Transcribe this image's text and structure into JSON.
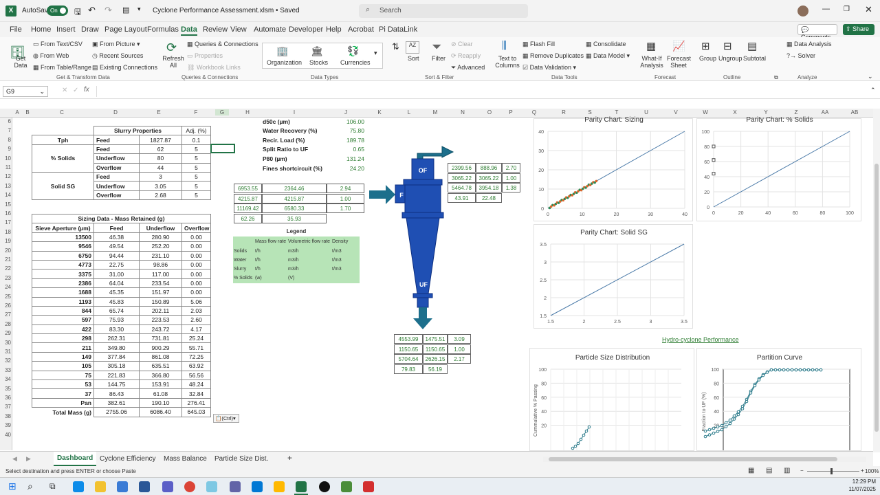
{
  "titlebar": {
    "app_letter": "X",
    "autosave_label": "AutoSave",
    "autosave_state": "On",
    "doc_title": "Cyclone Performance Assessment.xlsm • Saved",
    "search_placeholder": "Search"
  },
  "ribbon_tabs": [
    "File",
    "Home",
    "Insert",
    "Draw",
    "Page Layout",
    "Formulas",
    "Data",
    "Review",
    "View",
    "Automate",
    "Developer",
    "Help",
    "Acrobat",
    "Pi DataLink"
  ],
  "active_tab": "Data",
  "comments_label": "Comments",
  "share_label": "Share",
  "ribbon": {
    "get_data": "Get Data",
    "from_text_csv": "From Text/CSV",
    "from_web": "From Web",
    "from_table": "From Table/Range",
    "from_picture": "From Picture",
    "recent_sources": "Recent Sources",
    "existing_connections": "Existing Connections",
    "g1": "Get & Transform Data",
    "refresh_all": "Refresh All",
    "queries_connections": "Queries & Connections",
    "properties": "Properties",
    "workbook_links": "Workbook Links",
    "g2": "Queries & Connections",
    "organization": "Organization",
    "stocks": "Stocks",
    "currencies": "Currencies",
    "g3": "Data Types",
    "sort": "Sort",
    "filter": "Filter",
    "clear": "Clear",
    "reapply": "Reapply",
    "advanced": "Advanced",
    "g4": "Sort & Filter",
    "text_to_columns": "Text to Columns",
    "flash_fill": "Flash Fill",
    "remove_duplicates": "Remove Duplicates",
    "data_validation": "Data Validation",
    "consolidate": "Consolidate",
    "data_model": "Data Model",
    "g5": "Data Tools",
    "what_if": "What-If Analysis",
    "forecast_sheet": "Forecast Sheet",
    "g6": "Forecast",
    "group": "Group",
    "ungroup": "Ungroup",
    "subtotal": "Subtotal",
    "g7": "Outline",
    "data_analysis": "Data Analysis",
    "solver": "Solver",
    "g8": "Analyze"
  },
  "namebox": "G9",
  "columns": [
    "A",
    "B",
    "C",
    "D",
    "E",
    "F",
    "G",
    "H",
    "I",
    "J",
    "K",
    "L",
    "M",
    "N",
    "O",
    "P",
    "Q",
    "R",
    "S",
    "T",
    "U",
    "V",
    "W",
    "X",
    "Y",
    "Z",
    "AA",
    "AB"
  ],
  "rows": [
    "6",
    "7",
    "8",
    "9",
    "10",
    "11",
    "12",
    "13",
    "14",
    "15",
    "16",
    "17",
    "18",
    "19",
    "20",
    "21",
    "22",
    "23",
    "24",
    "25",
    "26",
    "27",
    "28",
    "29",
    "30",
    "31",
    "32",
    "33",
    "34",
    "35",
    "36",
    "37",
    "38",
    "39",
    "40"
  ],
  "slurry": {
    "title": "Slurry Properties",
    "adj_header": "Adj. (%)",
    "tph_label": "Tph",
    "solids_label": "% Solids",
    "sg_label": "Solid SG",
    "rows": [
      {
        "stream": "Feed",
        "value": "1827.87",
        "adj": "0.1"
      },
      {
        "stream": "Feed",
        "value": "62",
        "adj": "5"
      },
      {
        "stream": "Underflow",
        "value": "80",
        "adj": "5"
      },
      {
        "stream": "Overflow",
        "value": "44",
        "adj": "5"
      },
      {
        "stream": "Feed",
        "value": "3",
        "adj": "5"
      },
      {
        "stream": "Underflow",
        "value": "3.05",
        "adj": "5"
      },
      {
        "stream": "Overflow",
        "value": "2.68",
        "adj": "5"
      }
    ]
  },
  "sizing": {
    "title": "Sizing Data - Mass Retained (g)",
    "headers": [
      "Sieve Aperture (µm)",
      "Feed",
      "Underflow",
      "Overflow"
    ],
    "rows": [
      [
        "13500",
        "46.38",
        "280.90",
        "0.00"
      ],
      [
        "9546",
        "49.54",
        "252.20",
        "0.00"
      ],
      [
        "6750",
        "94.44",
        "231.10",
        "0.00"
      ],
      [
        "4773",
        "22.75",
        "98.86",
        "0.00"
      ],
      [
        "3375",
        "31.00",
        "117.00",
        "0.00"
      ],
      [
        "2386",
        "64.04",
        "233.54",
        "0.00"
      ],
      [
        "1688",
        "45.35",
        "151.97",
        "0.00"
      ],
      [
        "1193",
        "45.83",
        "150.89",
        "5.06"
      ],
      [
        "844",
        "65.74",
        "202.11",
        "2.03"
      ],
      [
        "597",
        "75.93",
        "223.53",
        "2.60"
      ],
      [
        "422",
        "83.30",
        "243.72",
        "4.17"
      ],
      [
        "298",
        "262.31",
        "731.81",
        "25.24"
      ],
      [
        "211",
        "349.80",
        "900.29",
        "55.71"
      ],
      [
        "149",
        "377.84",
        "861.08",
        "72.25"
      ],
      [
        "105",
        "305.18",
        "635.51",
        "63.92"
      ],
      [
        "75",
        "221.83",
        "366.80",
        "56.56"
      ],
      [
        "53",
        "144.75",
        "153.91",
        "48.24"
      ],
      [
        "37",
        "86.43",
        "61.08",
        "32.84"
      ],
      [
        "Pan",
        "382.61",
        "190.10",
        "276.41"
      ]
    ],
    "total_label": "Total Mass (g)",
    "totals": [
      "2755.06",
      "6086.40",
      "645.03"
    ]
  },
  "paste_ctrl": "(Ctrl)",
  "params": [
    {
      "label": "d50c (µm)",
      "value": "106.00"
    },
    {
      "label": "Water Recovery (%)",
      "value": "75.80"
    },
    {
      "label": "Recir. Load (%)",
      "value": "189.78"
    },
    {
      "label": "Split Ratio to UF",
      "value": "0.65"
    },
    {
      "label": "P80 (µm)",
      "value": "131.24"
    },
    {
      "label": "Fines shortcircuit (%)",
      "value": "24.20"
    }
  ],
  "feed_box": [
    [
      "6953.55",
      "2364.46",
      "2.94"
    ],
    [
      "4215.87",
      "4215.87",
      "1.00"
    ],
    [
      "11169.42",
      "6580.33",
      "1.70"
    ],
    [
      "62.26",
      "35.93",
      ""
    ]
  ],
  "of_box": [
    [
      "2399.56",
      "888.96",
      "2.70"
    ],
    [
      "3065.22",
      "3065.22",
      "1.00"
    ],
    [
      "5464.78",
      "3954.18",
      "1.38"
    ],
    [
      "43.91",
      "22.48",
      ""
    ]
  ],
  "uf_box": [
    [
      "4553.99",
      "1475.51",
      "3.09"
    ],
    [
      "1150.65",
      "1150.65",
      "1.00"
    ],
    [
      "5704.64",
      "2626.15",
      "2.17"
    ],
    [
      "79.83",
      "56.19",
      ""
    ]
  ],
  "legend": {
    "title": "Legend",
    "headers": [
      "Mass flow rate",
      "Volumetric flow rate",
      "Density"
    ],
    "rows": [
      [
        "Solids",
        "t/h",
        "m3/h",
        "t/m3"
      ],
      [
        "Water",
        "t/h",
        "m3/h",
        "t/m3"
      ],
      [
        "Slurry",
        "t/h",
        "m3/h",
        "t/m3"
      ],
      [
        "% Solids",
        "(w)",
        "(V)",
        ""
      ]
    ]
  },
  "cyclone_labels": {
    "of": "OF",
    "feed": "F",
    "uf": "UF"
  },
  "charts": {
    "sizing_title": "Parity Chart: Sizing",
    "solids_title": "Parity Chart: % Solids",
    "sg_title": "Parity Chart: Solid SG",
    "perf_link": "Hydro-cyclone Performance",
    "psd_title": "Particle Size Distribution",
    "psd_ylabel": "Cummulative % Passing",
    "partition_title": "Partition Curve",
    "partition_ylabel": "Fraction to UF (%)",
    "sizing_x_ticks": [
      "0",
      "10",
      "20",
      "30",
      "40"
    ],
    "sizing_y_ticks": [
      "0",
      "10",
      "20",
      "30",
      "40"
    ],
    "solids_x_ticks": [
      "0",
      "20",
      "40",
      "60",
      "80",
      "100"
    ],
    "solids_y_ticks": [
      "0",
      "20",
      "40",
      "60",
      "80",
      "100"
    ],
    "sg_x_ticks": [
      "1.5",
      "2",
      "2.5",
      "3",
      "3.5"
    ],
    "sg_y_ticks": [
      "1.5",
      "2",
      "2.5",
      "3",
      "3.5"
    ],
    "psd_y_ticks": [
      "20",
      "40",
      "60",
      "80",
      "100"
    ],
    "part_y_ticks": [
      "20",
      "40",
      "60",
      "80",
      "100"
    ]
  },
  "sheet_tabs": [
    "Dashboard",
    "Cyclone Efficiency",
    "Mass Balance",
    "Particle Size Dist."
  ],
  "active_sheet": "Dashboard",
  "status_text": "Select destination and press ENTER or choose Paste",
  "zoom": "100%",
  "clock": {
    "time": "12:29 PM",
    "date": "11/07/2025"
  },
  "colors": {
    "accent_green": "#217346",
    "cyclone_blue": "#1f4fb3",
    "arrow_teal": "#1d6f8c",
    "legend_bg": "#b7e4b7",
    "value_green": "#2e7d32"
  }
}
